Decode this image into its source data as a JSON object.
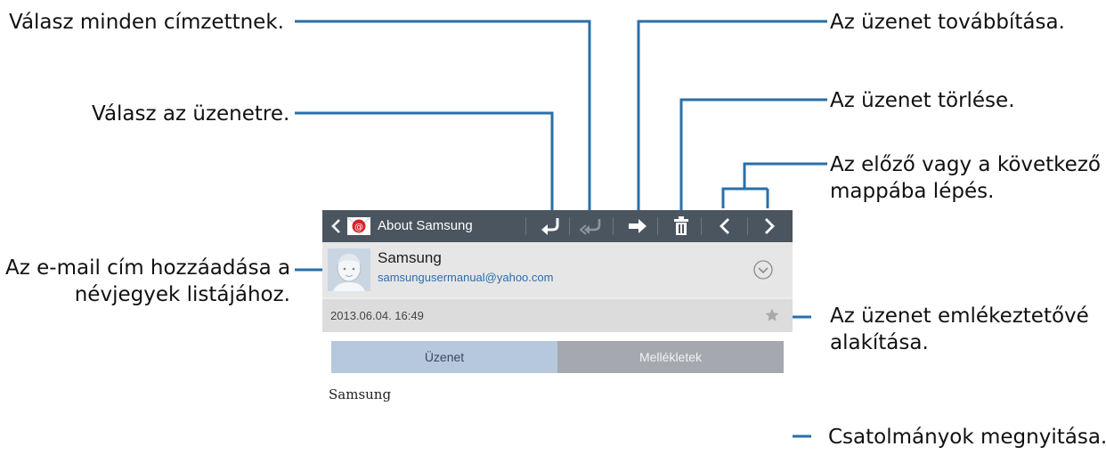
{
  "callouts": {
    "reply_all": "Válasz minden címzettnek.",
    "reply": "Válasz az üzenetre.",
    "add_contact_line1": "Az e-mail cím hozzáadása a",
    "add_contact_line2": "névjegyek listájához.",
    "forward": "Az üzenet továbbítása.",
    "delete": "Az üzenet törlése.",
    "prev_next_line1": "Az előző vagy a következő",
    "prev_next_line2": "mappába lépés.",
    "reminder_line1": "Az üzenet emlékeztetővé",
    "reminder_line2": "alakítása.",
    "attachments": "Csatolmányok megnyitása."
  },
  "actionbar": {
    "title": "About Samsung",
    "icons": [
      "back-icon",
      "email-app-icon",
      "reply-icon",
      "reply-all-icon",
      "forward-icon",
      "delete-icon",
      "previous-icon",
      "next-icon"
    ]
  },
  "message": {
    "sender_name": "Samsung",
    "sender_email": "samsungusermanual@yahoo.com",
    "datetime": "2013.06.04.  16:49",
    "body": "Samsung"
  },
  "tabs": {
    "message": "Üzenet",
    "attachments": "Mellékletek"
  },
  "colors": {
    "actionbar": "#4a5560",
    "callout_line": "#2a6fa8",
    "tab_active": "#b5c8de",
    "tab_inactive": "#a5a9af",
    "email_link": "#2b6fb0"
  }
}
